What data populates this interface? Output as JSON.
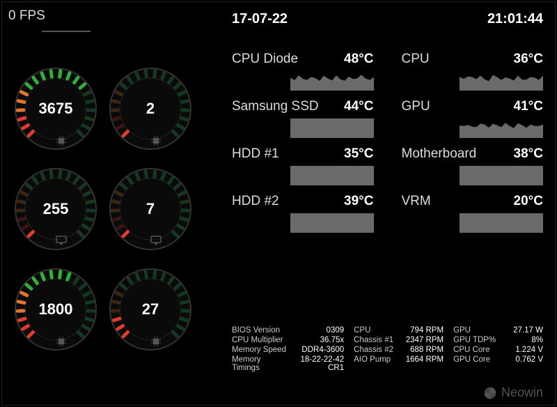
{
  "fps": "0 FPS",
  "date": "17-07-22",
  "time": "21:01:44",
  "gauges": [
    {
      "value": "3675",
      "fill": 0.7,
      "icon": "chip"
    },
    {
      "value": "2",
      "fill": 0.04,
      "icon": "chip"
    },
    {
      "value": "255",
      "fill": 0.06,
      "icon": "monitor"
    },
    {
      "value": "7",
      "fill": 0.05,
      "icon": "monitor"
    },
    {
      "value": "1800",
      "fill": 0.6,
      "icon": "chip"
    },
    {
      "value": "27",
      "fill": 0.16,
      "icon": "chip"
    }
  ],
  "temps": [
    {
      "label": "CPU Diode",
      "value": "48°C",
      "graph": "wave"
    },
    {
      "label": "CPU",
      "value": "36°C",
      "graph": "wave"
    },
    {
      "label": "Samsung SSD",
      "value": "44°C",
      "graph": "flat"
    },
    {
      "label": "GPU",
      "value": "41°C",
      "graph": "wave"
    },
    {
      "label": "HDD #1",
      "value": "35°C",
      "graph": "flat"
    },
    {
      "label": "Motherboard",
      "value": "38°C",
      "graph": "flat"
    },
    {
      "label": "HDD #2",
      "value": "39°C",
      "graph": "flat"
    },
    {
      "label": "VRM",
      "value": "20°C",
      "graph": "flat"
    }
  ],
  "info": {
    "col1": [
      {
        "k": "BIOS Version",
        "v": "0309"
      },
      {
        "k": "CPU Multiplier",
        "v": "36.75x"
      },
      {
        "k": "Memory Speed",
        "v": "DDR4-3600"
      },
      {
        "k": "Memory Timings",
        "v": "18-22-22-42 CR1"
      }
    ],
    "col2": [
      {
        "k": "CPU",
        "v": "794 RPM"
      },
      {
        "k": "Chassis #1",
        "v": "2347 RPM"
      },
      {
        "k": "Chassis #2",
        "v": "688 RPM"
      },
      {
        "k": "AIO Pump",
        "v": "1664 RPM"
      }
    ],
    "col3": [
      {
        "k": "GPU",
        "v": "27.17 W"
      },
      {
        "k": "GPU TDP%",
        "v": "8%"
      },
      {
        "k": "CPU Core",
        "v": "1.224 V"
      },
      {
        "k": "GPU Core",
        "v": "0.762 V"
      }
    ]
  },
  "watermark": "Neowin"
}
